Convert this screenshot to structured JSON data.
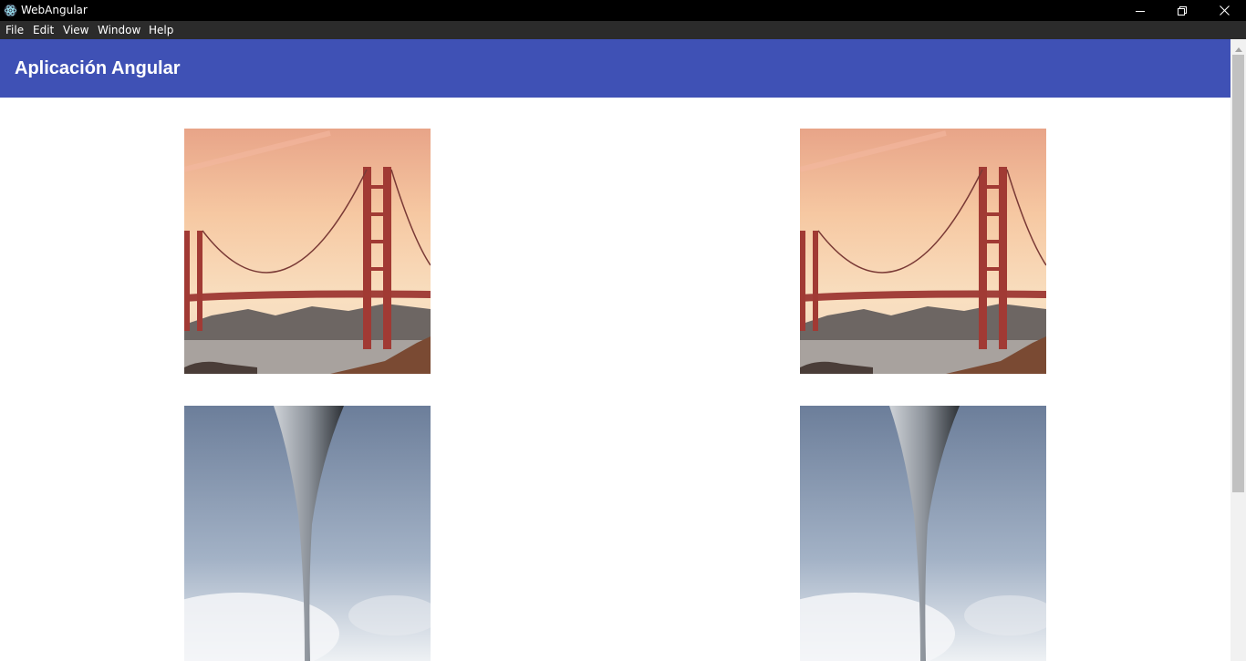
{
  "window": {
    "title": "WebAngular",
    "app_icon": "electron-atom-icon",
    "controls": [
      "minimize-icon",
      "restore-icon",
      "close-icon"
    ]
  },
  "menu": {
    "items": [
      {
        "label": "File"
      },
      {
        "label": "Edit"
      },
      {
        "label": "View"
      },
      {
        "label": "Window"
      },
      {
        "label": "Help"
      }
    ]
  },
  "toolbar": {
    "title": "Aplicación Angular",
    "color": "#3f51b5"
  },
  "gallery": {
    "images": [
      {
        "subject": "golden-gate-bridge-sunset"
      },
      {
        "subject": "golden-gate-bridge-sunset"
      },
      {
        "subject": "gateway-arch-sky"
      },
      {
        "subject": "gateway-arch-sky"
      }
    ]
  },
  "colors": {
    "titlebar": "#000000",
    "menubar": "#2b2b2b",
    "accent": "#3f51b5",
    "background": "#ffffff"
  }
}
